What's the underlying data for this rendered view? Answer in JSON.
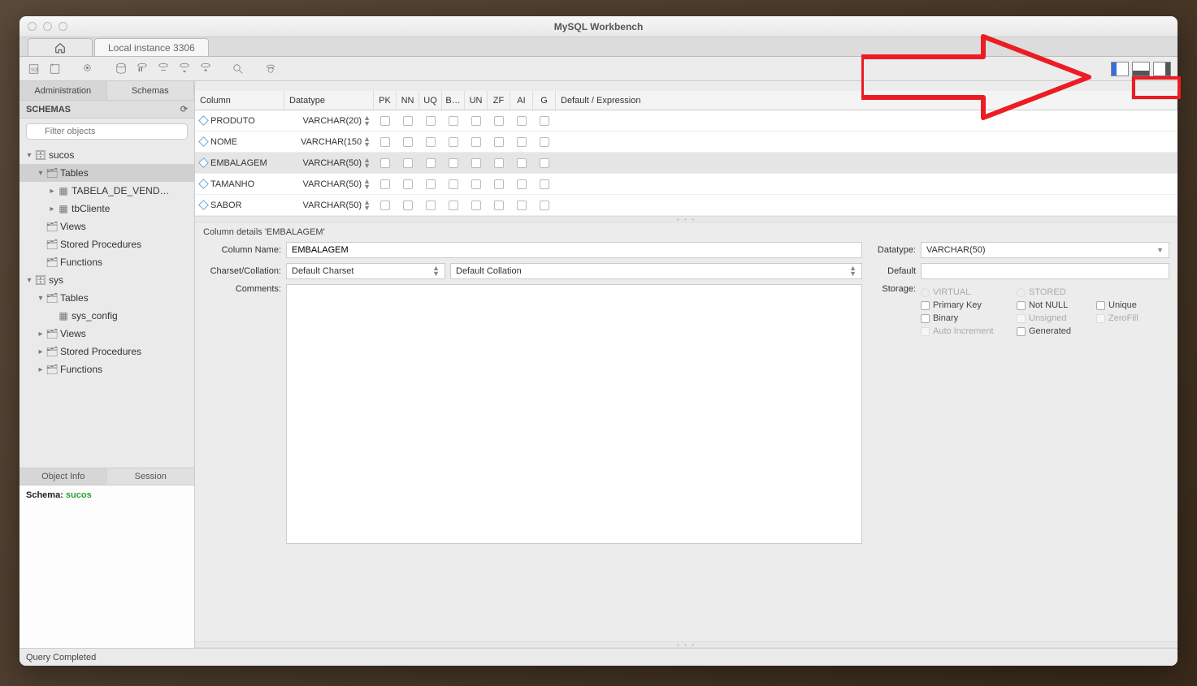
{
  "window": {
    "title": "MySQL Workbench"
  },
  "tabs": {
    "connection": "Local instance 3306"
  },
  "sidebar": {
    "tabs": {
      "admin": "Administration",
      "schemas": "Schemas"
    },
    "schemas_label": "SCHEMAS",
    "search_placeholder": "Filter objects",
    "tree": {
      "db1": "sucos",
      "db1_tables": "Tables",
      "db1_t1": "TABELA_DE_VEND…",
      "db1_t2": "tbCliente",
      "db1_views": "Views",
      "db1_sp": "Stored Procedures",
      "db1_fn": "Functions",
      "db2": "sys",
      "db2_tables": "Tables",
      "db2_t1": "sys_config",
      "db2_views": "Views",
      "db2_sp": "Stored Procedures",
      "db2_fn": "Functions"
    },
    "info_tabs": {
      "obj": "Object Info",
      "session": "Session"
    },
    "schema_label": "Schema:",
    "schema_value": "sucos"
  },
  "grid": {
    "headers": {
      "col": "Column",
      "dt": "Datatype",
      "pk": "PK",
      "nn": "NN",
      "uq": "UQ",
      "b": "B…",
      "un": "UN",
      "zf": "ZF",
      "ai": "AI",
      "g": "G",
      "def": "Default / Expression"
    },
    "rows": [
      {
        "name": "PRODUTO",
        "datatype": "VARCHAR(20)"
      },
      {
        "name": "NOME",
        "datatype": "VARCHAR(150"
      },
      {
        "name": "EMBALAGEM",
        "datatype": "VARCHAR(50)",
        "selected": true
      },
      {
        "name": "TAMANHO",
        "datatype": "VARCHAR(50)"
      },
      {
        "name": "SABOR",
        "datatype": "VARCHAR(50)"
      }
    ]
  },
  "details": {
    "header": "Column details 'EMBALAGEM'",
    "labels": {
      "col_name": "Column Name:",
      "charset": "Charset/Collation:",
      "comments": "Comments:",
      "datatype": "Datatype:",
      "default": "Default",
      "storage": "Storage:"
    },
    "values": {
      "col_name": "EMBALAGEM",
      "charset": "Default Charset",
      "collation": "Default Collation",
      "datatype": "VARCHAR(50)",
      "default": ""
    },
    "options": {
      "virtual": "VIRTUAL",
      "stored": "STORED",
      "pk": "Primary Key",
      "notnull": "Not NULL",
      "unique": "Unique",
      "binary": "Binary",
      "unsigned": "Unsigned",
      "zerofill": "ZeroFill",
      "autoinc": "Auto Increment",
      "generated": "Generated"
    }
  },
  "status": "Query Completed"
}
